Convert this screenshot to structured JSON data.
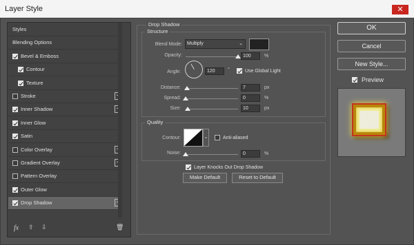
{
  "window": {
    "title": "Layer Style",
    "close_glyph": "✕"
  },
  "left_panel": {
    "items": [
      {
        "label": "Styles",
        "checkbox": false,
        "checked": false,
        "indent": false,
        "plus": false
      },
      {
        "label": "Blending Options",
        "checkbox": false,
        "checked": false,
        "indent": false,
        "plus": false
      },
      {
        "label": "Bevel & Emboss",
        "checkbox": true,
        "checked": true,
        "indent": false,
        "plus": false
      },
      {
        "label": "Contour",
        "checkbox": true,
        "checked": true,
        "indent": true,
        "plus": false
      },
      {
        "label": "Texture",
        "checkbox": true,
        "checked": true,
        "indent": true,
        "plus": false
      },
      {
        "label": "Stroke",
        "checkbox": true,
        "checked": false,
        "indent": false,
        "plus": true
      },
      {
        "label": "Inner Shadow",
        "checkbox": true,
        "checked": true,
        "indent": false,
        "plus": true
      },
      {
        "label": "Inner Glow",
        "checkbox": true,
        "checked": true,
        "indent": false,
        "plus": false
      },
      {
        "label": "Satin",
        "checkbox": true,
        "checked": true,
        "indent": false,
        "plus": false
      },
      {
        "label": "Color Overlay",
        "checkbox": true,
        "checked": false,
        "indent": false,
        "plus": true
      },
      {
        "label": "Gradient Overlay",
        "checkbox": true,
        "checked": false,
        "indent": false,
        "plus": true
      },
      {
        "label": "Pattern Overlay",
        "checkbox": true,
        "checked": false,
        "indent": false,
        "plus": false
      },
      {
        "label": "Outer Glow",
        "checkbox": true,
        "checked": true,
        "indent": false,
        "plus": false
      },
      {
        "label": "Drop Shadow",
        "checkbox": true,
        "checked": true,
        "indent": false,
        "plus": true,
        "selected": true
      }
    ],
    "fx_label": "fx"
  },
  "drop_shadow": {
    "title": "Drop Shadow",
    "structure_title": "Structure",
    "blend_mode_label": "Blend Mode:",
    "blend_mode_value": "Multiply",
    "shadow_color": "#222222",
    "opacity_label": "Opacity:",
    "opacity_value": "100",
    "opacity_unit": "%",
    "opacity_fraction": 1.0,
    "angle_label": "Angle:",
    "angle_value": "120",
    "angle_unit": "°",
    "global_light_label": "Use Global Light",
    "distance_label": "Distance:",
    "distance_value": "7",
    "distance_unit": "px",
    "distance_fraction": 0.02,
    "spread_label": "Spread:",
    "spread_value": "0",
    "spread_unit": "%",
    "spread_fraction": 0.0,
    "size_label": "Size:",
    "size_value": "10",
    "size_unit": "px",
    "size_fraction": 0.04
  },
  "quality": {
    "title": "Quality",
    "contour_label": "Contour:",
    "anti_aliased_label": "Anti-aliased",
    "noise_label": "Noise:",
    "noise_value": "0",
    "noise_unit": "%",
    "noise_fraction": 0.0
  },
  "knockout_label": "Layer Knocks Out Drop Shadow",
  "make_default_label": "Make Default",
  "reset_default_label": "Reset to Default",
  "buttons": {
    "ok": "OK",
    "cancel": "Cancel",
    "new_style": "New Style...",
    "preview": "Preview"
  }
}
